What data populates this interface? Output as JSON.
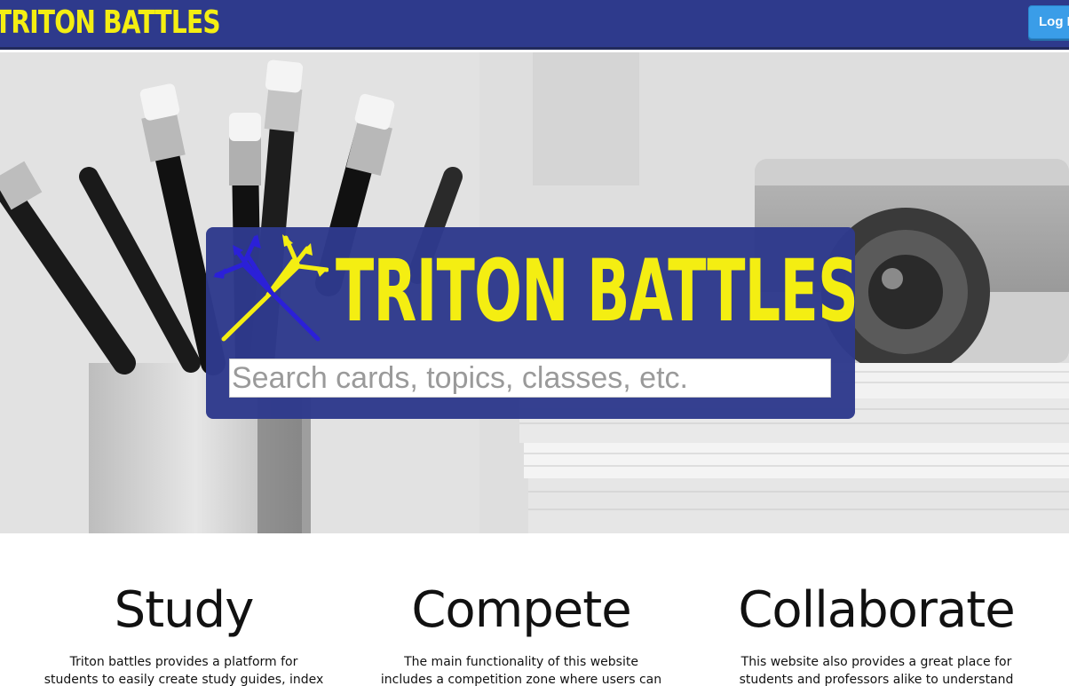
{
  "navbar": {
    "brand": "TRITON BATTLES",
    "login_label": "Log In"
  },
  "hero": {
    "title": "TRITON BATTLES",
    "logo_icon": "trident-icon",
    "search": {
      "placeholder": "Search cards, topics, classes, etc.",
      "value": ""
    }
  },
  "features": [
    {
      "title": "Study",
      "text": "Triton battles provides a platform for students to easily create study guides, index cards, and"
    },
    {
      "title": "Compete",
      "text": "The main functionality of this website includes a competition zone where users can"
    },
    {
      "title": "Collaborate",
      "text": "This website also provides a great place for students and professors alike to understand"
    }
  ],
  "colors": {
    "brand_blue": "#2e3a8c",
    "brand_yellow": "#f4ee12",
    "button_blue": "#3a9de8"
  }
}
